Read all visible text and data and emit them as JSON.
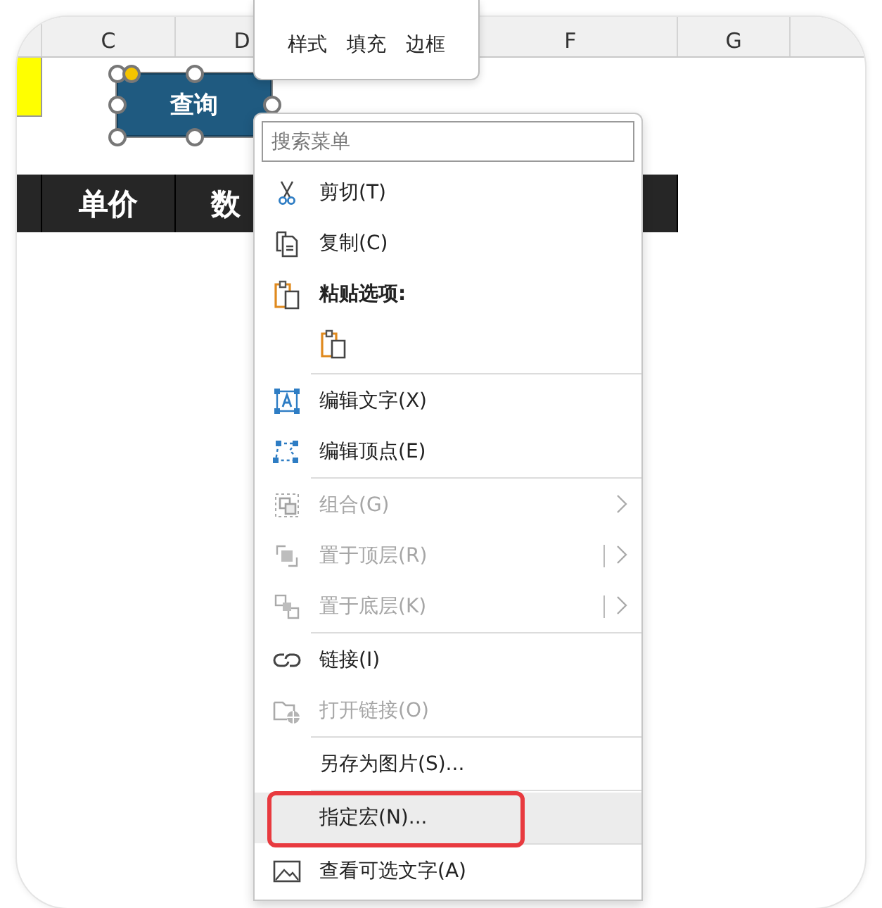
{
  "sheet": {
    "columns": [
      {
        "label": "C"
      },
      {
        "label": "D"
      },
      {
        "label": "F"
      },
      {
        "label": "G"
      }
    ],
    "header_row": [
      "单价",
      "数"
    ]
  },
  "shape": {
    "label": "查询",
    "selected": true
  },
  "mini_toolbar": {
    "items": [
      "样式",
      "填充",
      "边框"
    ]
  },
  "context_menu": {
    "search": {
      "placeholder": "搜索菜单"
    },
    "items": [
      {
        "kind": "command",
        "label": "剪切(T)",
        "disabled": false,
        "highlighted": false,
        "outlined": false
      },
      {
        "kind": "command",
        "label": "复制(C)",
        "disabled": false,
        "highlighted": false,
        "outlined": false
      },
      {
        "kind": "heading",
        "label": "粘贴选项:"
      },
      {
        "kind": "paste-options"
      },
      {
        "kind": "separator"
      },
      {
        "kind": "command",
        "label": "编辑文字(X)",
        "disabled": false,
        "highlighted": false,
        "outlined": false
      },
      {
        "kind": "command",
        "label": "编辑顶点(E)",
        "disabled": false,
        "highlighted": false,
        "outlined": false
      },
      {
        "kind": "separator"
      },
      {
        "kind": "command",
        "label": "组合(G)",
        "disabled": true,
        "highlighted": false,
        "outlined": false,
        "submenu": true,
        "split": false
      },
      {
        "kind": "command",
        "label": "置于顶层(R)",
        "disabled": true,
        "highlighted": false,
        "outlined": false,
        "submenu": true,
        "split": true
      },
      {
        "kind": "command",
        "label": "置于底层(K)",
        "disabled": true,
        "highlighted": false,
        "outlined": false,
        "submenu": true,
        "split": true
      },
      {
        "kind": "separator"
      },
      {
        "kind": "command",
        "label": "链接(I)",
        "disabled": false,
        "highlighted": false,
        "outlined": false
      },
      {
        "kind": "command",
        "label": "打开链接(O)",
        "disabled": true,
        "highlighted": false,
        "outlined": false
      },
      {
        "kind": "separator"
      },
      {
        "kind": "command",
        "label": "另存为图片(S)...",
        "disabled": false,
        "highlighted": false,
        "outlined": false
      },
      {
        "kind": "separator"
      },
      {
        "kind": "command",
        "label": "指定宏(N)...",
        "disabled": false,
        "highlighted": true,
        "outlined": true
      },
      {
        "kind": "separator"
      },
      {
        "kind": "command",
        "label": "查看可选文字(A)",
        "disabled": false,
        "highlighted": false,
        "outlined": false
      }
    ]
  }
}
